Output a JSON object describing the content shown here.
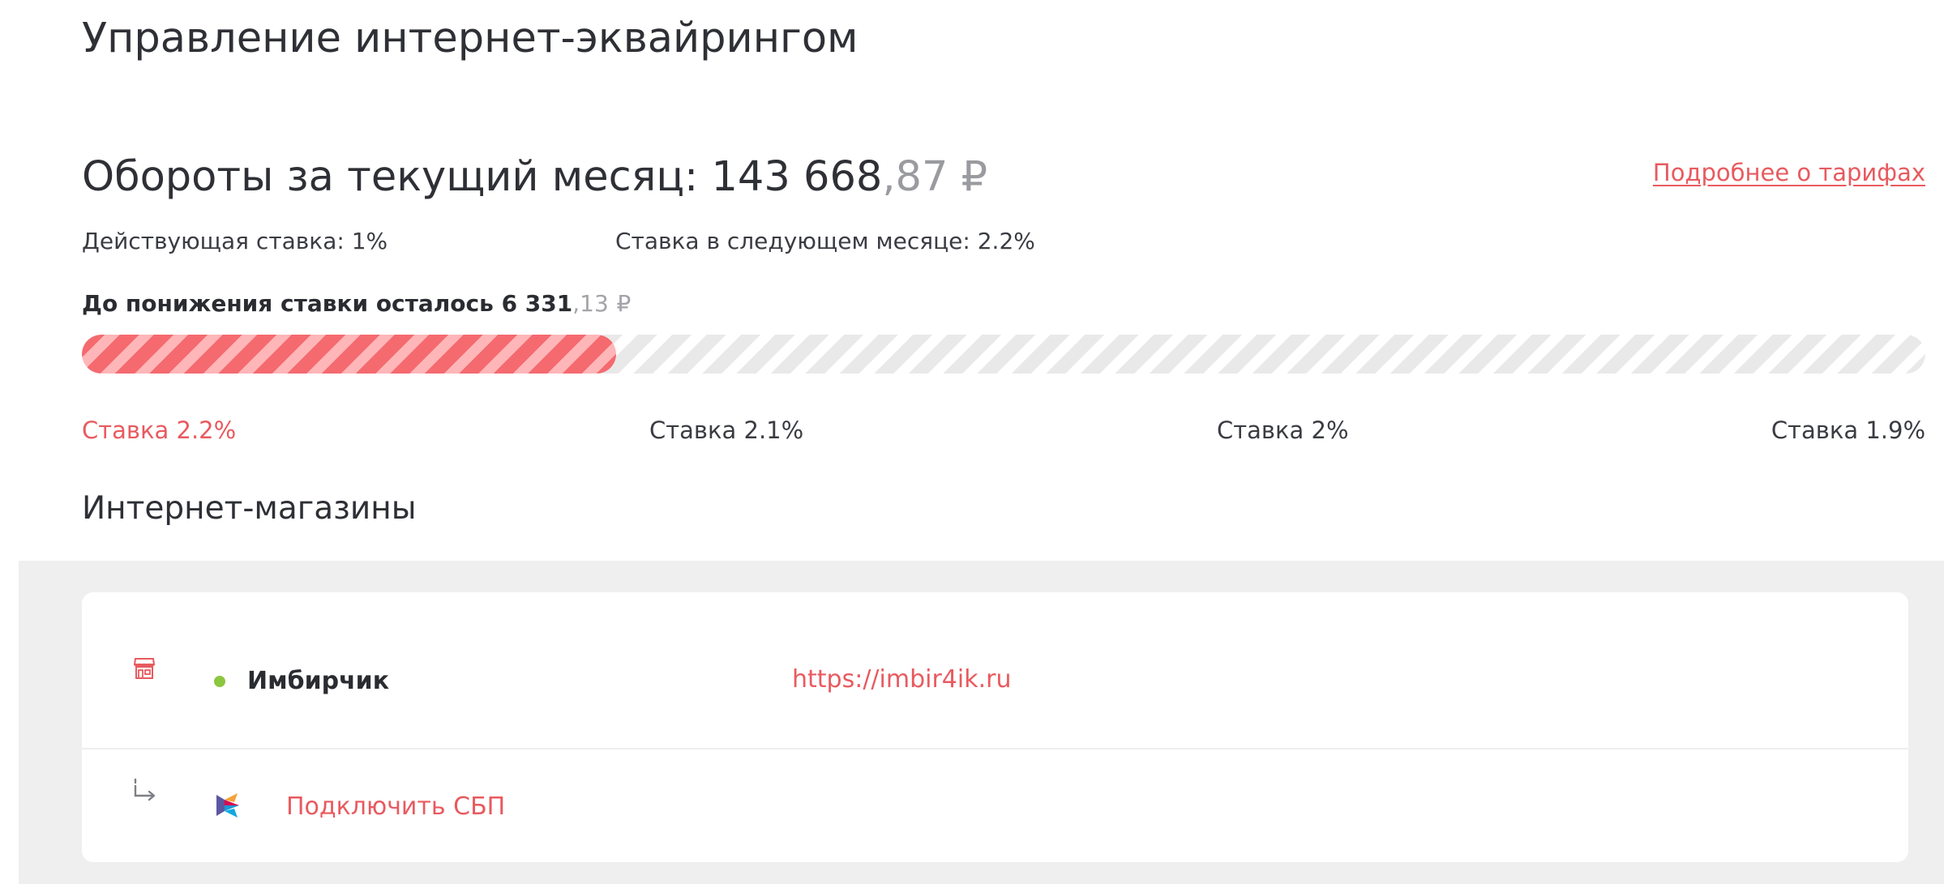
{
  "page": {
    "title": "Управление интернет-эквайрингом"
  },
  "turnover": {
    "label": "Обороты за текущий месяц:",
    "amount_whole": "143 668",
    "amount_cents": ",87",
    "currency": "₽"
  },
  "tariffs_link": "Подробнее о тарифах",
  "rates": {
    "current": "Действующая ставка: 1%",
    "next_month": "Ставка в следующем месяце: 2.2%"
  },
  "remaining": {
    "label": "До понижения ставки осталось",
    "amount_whole": "6 331",
    "amount_cents": ",13",
    "currency": "₽"
  },
  "progress": {
    "fraction": 0.29
  },
  "rate_steps": [
    {
      "label": "Ставка 2.2%",
      "active": true
    },
    {
      "label": "Ставка 2.1%",
      "active": false
    },
    {
      "label": "Ставка 2%",
      "active": false
    },
    {
      "label": "Ставка 1.9%",
      "active": false
    }
  ],
  "shops": {
    "title": "Интернет-магазины",
    "items": [
      {
        "name": "Имбирчик",
        "url": "https://imbir4ik.ru",
        "status": "active",
        "sbp_action": "Подключить СБП"
      }
    ]
  },
  "colors": {
    "accent": "#e85a5f",
    "status_active": "#8cc63f",
    "progress_fill": "#f46a6f",
    "text_primary": "#2e3036",
    "text_muted": "#9a9b9f",
    "background_section": "#efefef"
  },
  "icons": {
    "shop": "storefront-icon",
    "status": "status-dot",
    "connector": "branch-arrow-icon",
    "sbp": "sbp-logo-icon"
  }
}
